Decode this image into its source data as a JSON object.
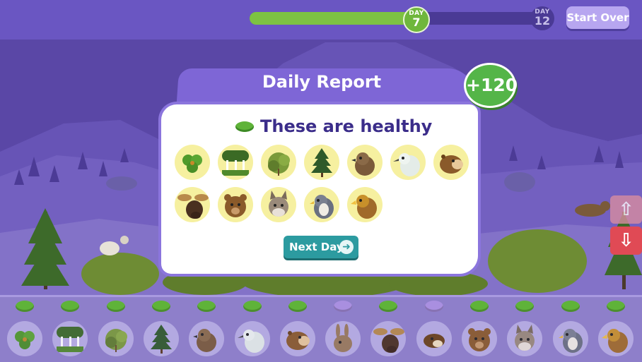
{
  "progress": {
    "fraction": 0.55,
    "current_day": {
      "label": "DAY",
      "number": "7"
    },
    "total_day": {
      "label": "DAY",
      "number": "12"
    }
  },
  "buttons": {
    "start_over": "Start Over",
    "next_day": "Next Day",
    "next_day_icon": "arrow-right-icon"
  },
  "report": {
    "title": "Daily Report",
    "score": "+120",
    "status_text": "These are healthy",
    "status_color": "#5fb339",
    "species": [
      "clover",
      "mushrooms",
      "shrub",
      "pine-tree",
      "grouse",
      "ptarmigan",
      "marmot",
      "moose",
      "bear",
      "lynx",
      "falcon",
      "eagle"
    ]
  },
  "side_controls": {
    "up_icon": "arrow-up-icon",
    "down_icon": "arrow-down-icon"
  },
  "tray": {
    "health_colors": [
      "#5fb339",
      "#5fb339",
      "#5fb339",
      "#5fb339",
      "#5fb339",
      "#5fb339",
      "#5fb339",
      "#a98fe0",
      "#5fb339",
      "#a98fe0",
      "#5fb339",
      "#5fb339",
      "#5fb339",
      "#5fb339"
    ],
    "species": [
      "clover",
      "mushrooms",
      "shrub",
      "pine-tree",
      "grouse",
      "ptarmigan",
      "marmot",
      "hare",
      "moose",
      "weasel",
      "bear",
      "lynx",
      "falcon",
      "eagle"
    ]
  }
}
